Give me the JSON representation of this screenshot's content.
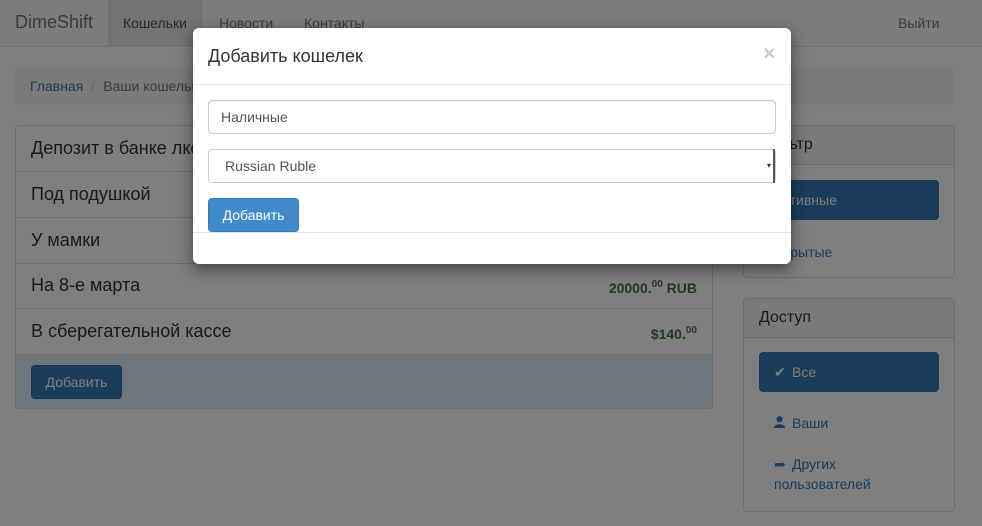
{
  "navbar": {
    "brand": "DimeShift",
    "items": [
      {
        "label": "Кошельки",
        "active": true
      },
      {
        "label": "Новости"
      },
      {
        "label": "Контакты"
      }
    ],
    "logout": "Выйти"
  },
  "breadcrumb": {
    "home": "Главная",
    "current": "Ваши кошельки"
  },
  "wallets": [
    {
      "name": "Депозит в банке лкс",
      "balance_main": "",
      "balance_cents": "",
      "balance_suffix": ""
    },
    {
      "name": "Под подушкой",
      "balance_main": "",
      "balance_cents": "",
      "balance_suffix": ""
    },
    {
      "name": "У мамки",
      "balance_main": "",
      "balance_cents": "",
      "balance_suffix": ""
    },
    {
      "name": "На 8-е марта",
      "balance_main": "20000.",
      "balance_cents": "00",
      "balance_suffix": " RUB"
    },
    {
      "name": "В сберегательной кассе",
      "balance_main": "$140.",
      "balance_cents": "00",
      "balance_suffix": ""
    }
  ],
  "wallet_add_button": "Добавить",
  "filter_panel": {
    "heading": "Фильтр",
    "items": [
      {
        "label": "Активные",
        "active": true
      },
      {
        "label": "Скрытые"
      }
    ]
  },
  "access_panel": {
    "heading": "Доступ",
    "items": [
      {
        "label": "Все",
        "icon": "check-icon",
        "active": true
      },
      {
        "label": "Ваши",
        "icon": "user-icon"
      },
      {
        "label": "Других пользователей",
        "icon": "share-arrow-icon"
      }
    ]
  },
  "modal": {
    "title": "Добавить кошелек",
    "close": "×",
    "name_value": "Наличные",
    "currency_value": "Russian Ruble",
    "submit": "Добавить"
  },
  "colors": {
    "primary": "#337ab7",
    "balance_green": "#3c763d",
    "info_bg": "#d9edf7"
  }
}
